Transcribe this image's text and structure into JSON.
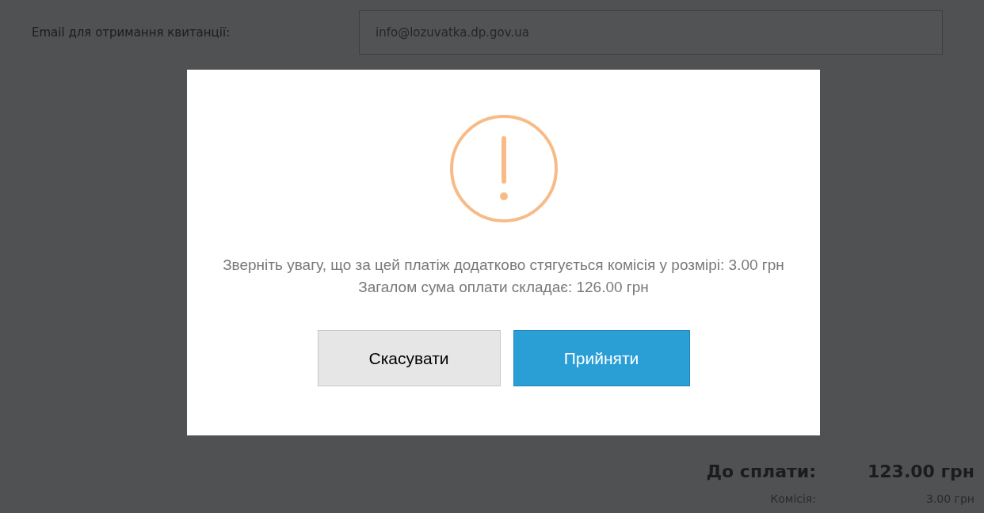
{
  "form": {
    "email_label": "Email для отримання квитанції:",
    "email_value": "info@lozuvatka.dp.gov.ua"
  },
  "dialog": {
    "message": "Зверніть увагу, що за цей платіж додатково стягується комісія у розмірі: 3.00 грн",
    "total": "Загалом сума оплати складає: 126.00 грн",
    "buttons": [
      {
        "label": "Скасувати",
        "kind": "cancel"
      },
      {
        "label": "Прийняти",
        "kind": "confirm"
      }
    ]
  },
  "summary": [
    {
      "label": "До сплати:",
      "value": "123.00 грн",
      "kind": "total"
    },
    {
      "label": "Комісія:",
      "value": "3.00 грн",
      "kind": "fee"
    }
  ]
}
